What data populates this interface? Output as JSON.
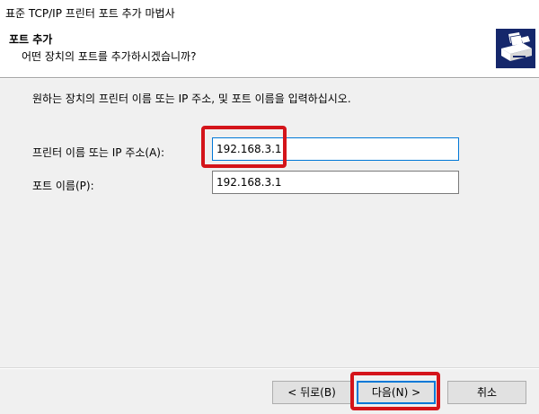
{
  "window": {
    "title": "표준 TCP/IP 프린터 포트 추가 마법사"
  },
  "header": {
    "title": "포트 추가",
    "subtitle": "어떤 장치의 포트를 추가하시겠습니까?",
    "icon": "printer-wizard-icon"
  },
  "main": {
    "instruction": "원하는 장치의 프린터 이름 또는 IP 주소, 및 포트 이름을 입력하십시오.",
    "fields": [
      {
        "label": "프린터 이름 또는 IP 주소(A):",
        "value": "192.168.3.1"
      },
      {
        "label": "포트 이름(P):",
        "value": "192.168.3.1"
      }
    ]
  },
  "buttons": {
    "back": "< 뒤로(B)",
    "next": "다음(N) >",
    "cancel": "취소"
  },
  "colors": {
    "highlight": "#d4141a",
    "icon_bg": "#15276b",
    "focus": "#0078d7",
    "dialog_bg": "#f0f0f0"
  }
}
